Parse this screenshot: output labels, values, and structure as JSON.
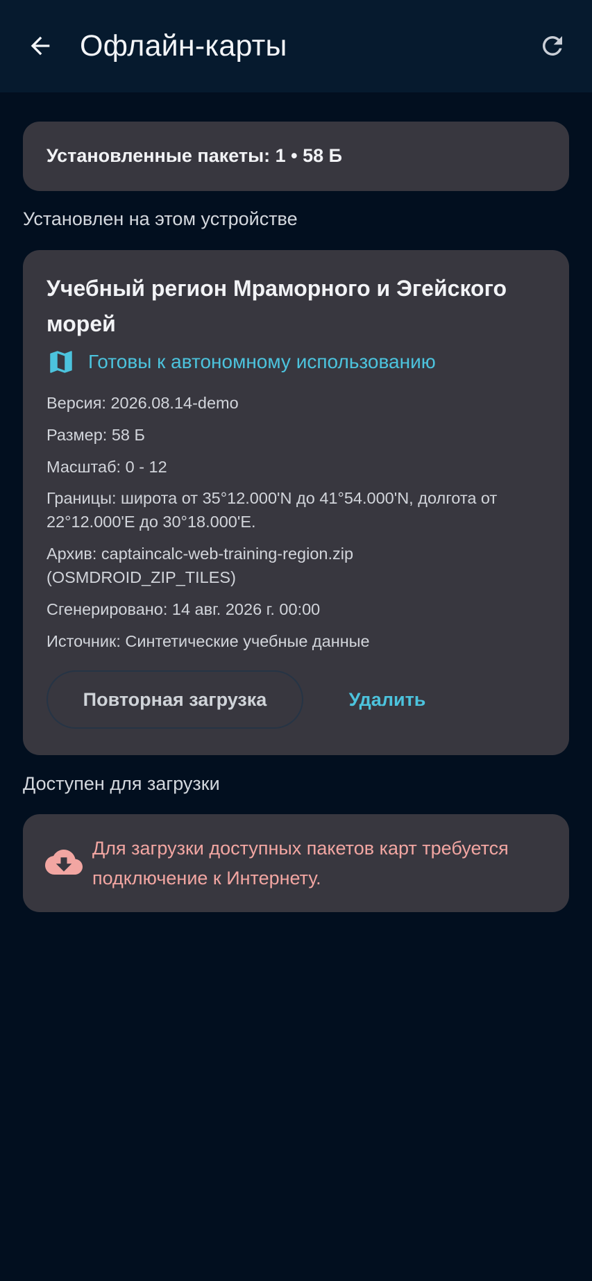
{
  "appbar": {
    "title": "Офлайн-карты",
    "back_icon": "arrow-back-icon",
    "refresh_icon": "refresh-icon"
  },
  "summary": {
    "text": "Установленные пакеты: 1 • 58 Б"
  },
  "installed_section": {
    "label": "Установлен на этом устройстве"
  },
  "package": {
    "title": "Учебный регион Мраморного и Эгейского морей",
    "status_icon": "map-icon",
    "status": "Готовы к автономному использованию",
    "details": {
      "version": "Версия: 2026.08.14-demo",
      "size": "Размер: 58 Б",
      "scale": "Масштаб: 0 - 12",
      "bounds": "Границы: широта от 35°12.000'N до 41°54.000'N, долгота от 22°12.000'E до 30°18.000'E.",
      "archive": "Архив: captaincalc-web-training-region.zip (OSMDROID_ZIP_TILES)",
      "generated": "Сгенерировано: 14 авг. 2026 г. 00:00",
      "source": "Источник: Синтетические учебные данные"
    },
    "redownload_label": "Повторная загрузка",
    "delete_label": "Удалить"
  },
  "available_section": {
    "label": "Доступен для загрузки",
    "icon": "cloud-download-icon",
    "message": "Для загрузки доступных пакетов карт требуется подключение к Интернету."
  },
  "colors": {
    "background": "#020f1f",
    "appbar": "#061a2e",
    "card": "#38373f",
    "accent": "#4cc3dd",
    "warning": "#f2a6a2"
  }
}
